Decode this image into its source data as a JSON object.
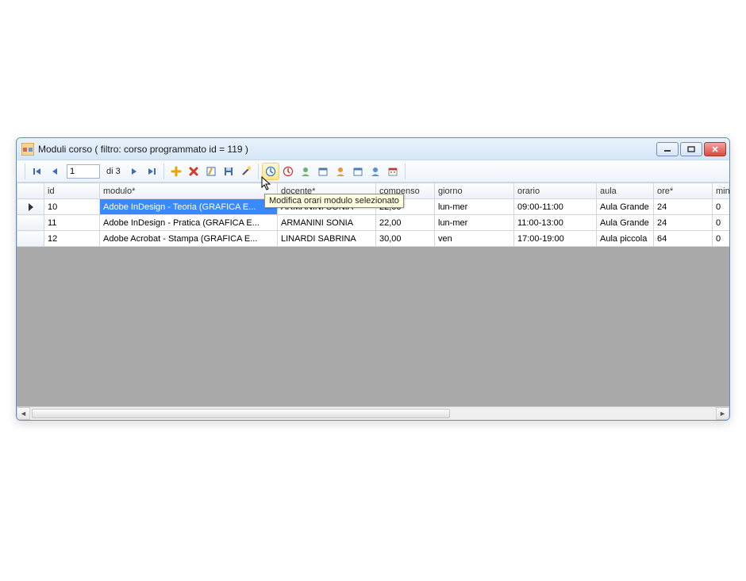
{
  "window": {
    "title": "Moduli corso ( filtro: corso programmato id = 119 )"
  },
  "toolbar": {
    "nav_position": "1",
    "nav_count_label": "di 3"
  },
  "tooltip": {
    "text": "Modifica orari modulo selezionato"
  },
  "grid": {
    "columns": [
      "",
      "id",
      "modulo*",
      "docente*",
      "compenso",
      "giorno",
      "orario",
      "aula",
      "ore*",
      "minuti*"
    ],
    "rows": [
      {
        "selected": true,
        "id": "10",
        "modulo": "Adobe InDesign - Teoria (GRAFICA E...",
        "docente": "ARMANINI SONIA",
        "compenso": "22,00",
        "giorno": "lun-mer",
        "orario": "09:00-11:00",
        "aula": "Aula Grande",
        "ore": "24",
        "minuti": "0"
      },
      {
        "selected": false,
        "id": "11",
        "modulo": "Adobe InDesign - Pratica (GRAFICA E...",
        "docente": "ARMANINI SONIA",
        "compenso": "22,00",
        "giorno": "lun-mer",
        "orario": "11:00-13:00",
        "aula": "Aula Grande",
        "ore": "24",
        "minuti": "0"
      },
      {
        "selected": false,
        "id": "12",
        "modulo": "Adobe Acrobat - Stampa (GRAFICA E...",
        "docente": "LINARDI SABRINA",
        "compenso": "30,00",
        "giorno": "ven",
        "orario": "17:00-19:00",
        "aula": "Aula piccola",
        "ore": "64",
        "minuti": "0"
      }
    ]
  }
}
